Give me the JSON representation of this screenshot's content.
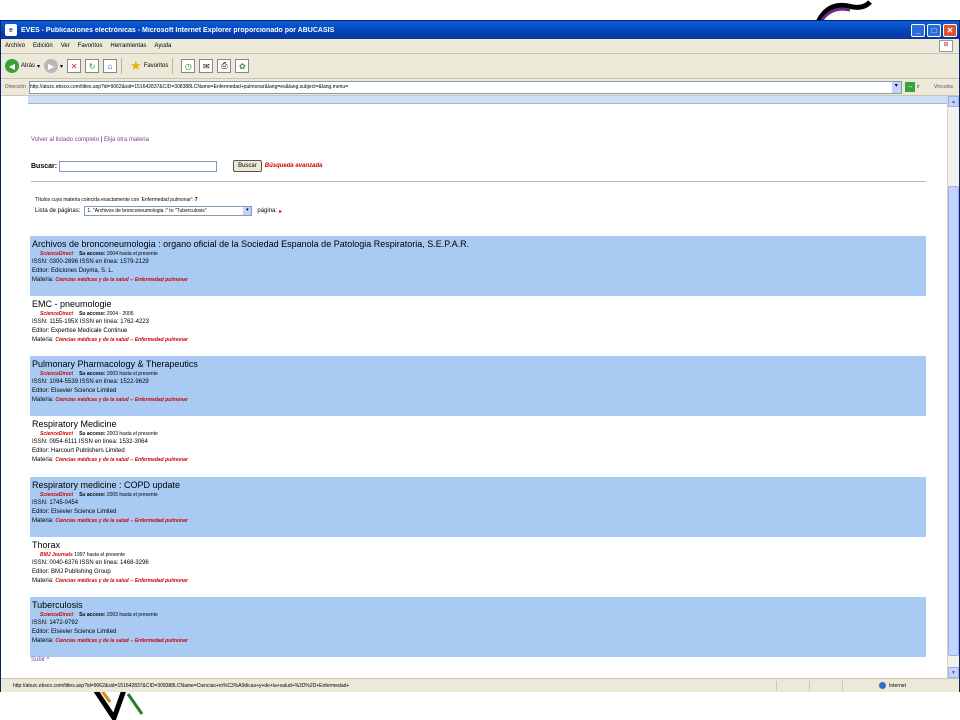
{
  "window": {
    "title": "EVES - Publicaciones electrónicas - Microsoft Internet Explorer proporcionado por ABUCASIS"
  },
  "menu": [
    "Archivo",
    "Edición",
    "Ver",
    "Favoritos",
    "Herramientas",
    "Ayuda"
  ],
  "toolbar": {
    "back_label": "Atrás",
    "favorites_label": "Favoritos"
  },
  "address": {
    "label": "Dirección",
    "url": "http://atozc.ebsco.com/titles.asp?id=9062&sid=151642837&CID=308388LCName=Enfermedad+pulmonar&lang=es&lang.subject=&lang.menu=",
    "go_label": "Ir",
    "links_label": "Vínculos"
  },
  "nav": {
    "back_link": "Volver al listado completo",
    "separator": "|",
    "other_link": "Elija otra materia"
  },
  "search": {
    "label": "Buscar:",
    "value": "",
    "button": "Buscar",
    "advanced": "Búsqueda avanzada"
  },
  "summary": {
    "text": "Títulos cuya materia coincida exactamente con 'Enfermedad pulmonar':",
    "count": "7",
    "pages_label": "Lista de páginas:",
    "pages_value": "1. \"Archivos de bronconeumologia :\" to \"Tuberculosis\"",
    "page_label": "página:"
  },
  "labels": {
    "access": "Su acceso:",
    "materia": "Materia:",
    "materia_value": "Ciencias médicas y de la salud -- Enfermedad pulmonar"
  },
  "entries": [
    {
      "title": "Archivos de bronconeumologia : organo oficial de la Sociedad Espanola de Patologia Respiratoria, S.E.P.A.R.",
      "provider": "ScienceDirect",
      "access": "2004 hasta el presente",
      "issn": "ISSN: 0300-2896 ISSN en línea: 1579-2129",
      "editor": "Editor: Ediciones Doyma, S. L."
    },
    {
      "title": "EMC - pneumologie",
      "provider": "ScienceDirect",
      "access": "2004 - 2005",
      "issn": "ISSN: 1155-195X ISSN en línea: 1762-4223",
      "editor": "Editor: Expertise Medicale Continue"
    },
    {
      "title": "Pulmonary Pharmacology & Therapeutics",
      "provider": "ScienceDirect",
      "access": "2003 hasta el presente",
      "issn": "ISSN: 1094-5539 ISSN en línea: 1522-9629",
      "editor": "Editor: Elsevier Science Limited"
    },
    {
      "title": "Respiratory Medicine",
      "provider": "ScienceDirect",
      "access": "2003 hasta el presente",
      "issn": "ISSN: 0954-6111 ISSN en línea: 1532-3064",
      "editor": "Editor: Harcourt Publishers Limited"
    },
    {
      "title": "Respiratory medicine : COPD update",
      "provider": "ScienceDirect",
      "access": "2005 hasta el presente",
      "issn": "ISSN: 1745-0454",
      "editor": "Editor: Elsevier Science Limited"
    },
    {
      "title": "Thorax",
      "provider": "BMJ Journals",
      "access": "1997 hasta el presente",
      "issn": "ISSN: 0040-6376 ISSN en línea: 1468-3296",
      "editor": "Editor: BMJ Publishing Group"
    },
    {
      "title": "Tuberculosis",
      "provider": "ScienceDirect",
      "access": "2003 hasta el presente",
      "issn": "ISSN: 1472-9792",
      "editor": "Editor: Elsevier Science Limited"
    }
  ],
  "subir": "Subir ^",
  "status": {
    "url": "http://atozc.ebsco.com/titles.asp?id=9062&sid=151642837&CID=308388LCName=Ciencias+m%C3%A9dicas+y+de+la+salud+%2D%2D+Enfermedad+",
    "zone": "Internet"
  }
}
